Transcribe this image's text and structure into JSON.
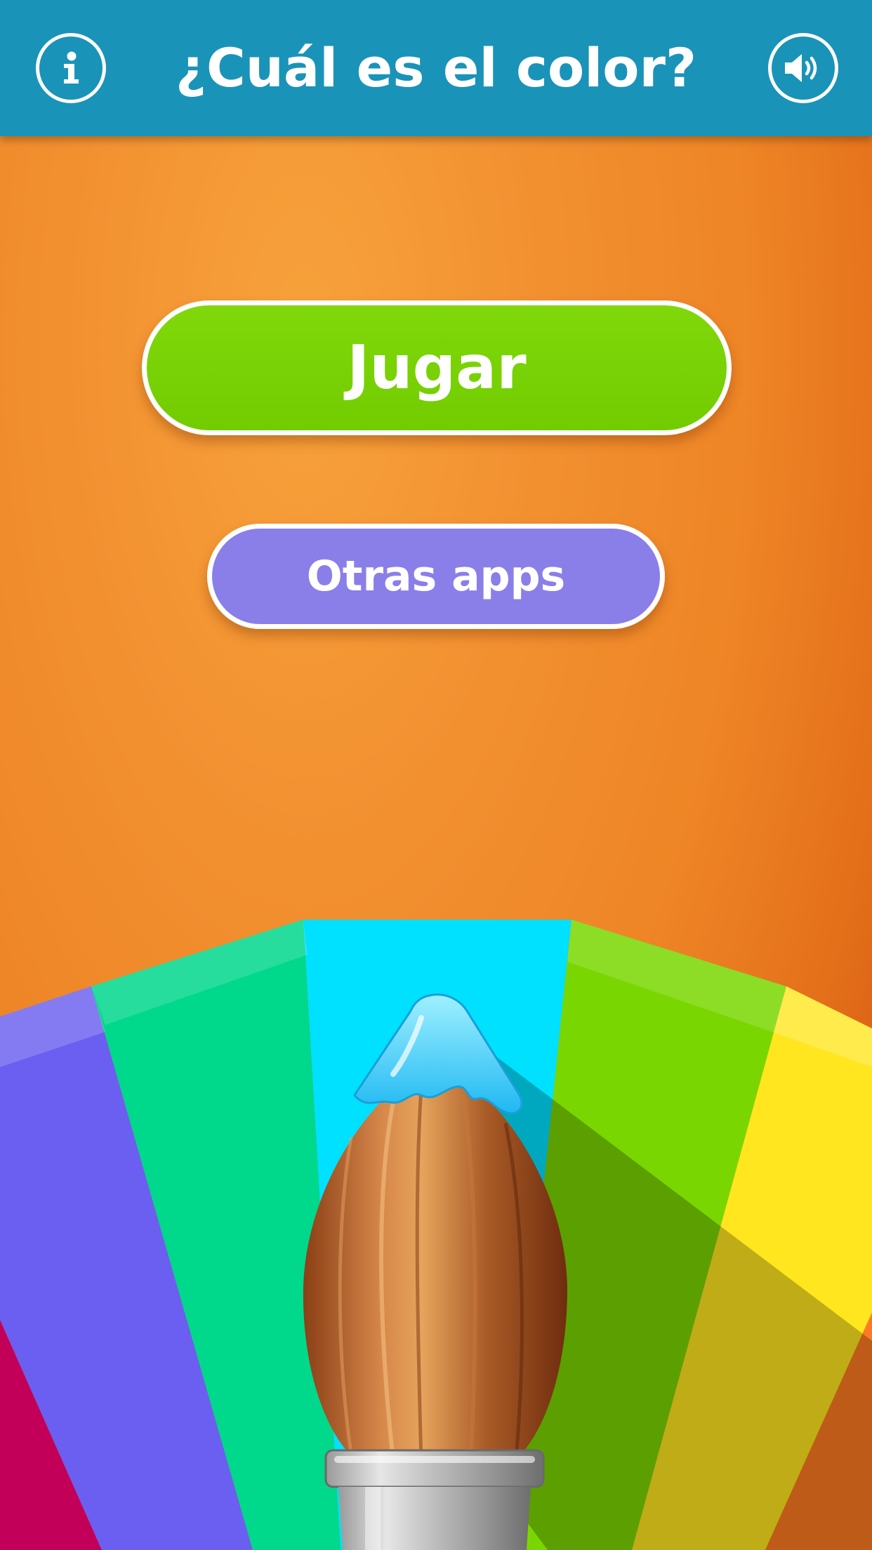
{
  "header": {
    "title": "¿Cuál es el color?",
    "info_icon": "info-icon",
    "sound_icon": "speaker-icon"
  },
  "menu": {
    "play_label": "Jugar",
    "other_apps_label": "Otras apps"
  },
  "colors": {
    "header_bg": "#1a93b8",
    "background": "#ee8526",
    "play_button": "#76cf00",
    "other_apps_button": "#8a7fe8",
    "wheel_segments": [
      "#c2005a",
      "#6a5ff0",
      "#00d88c",
      "#00e0ff",
      "#7ad600",
      "#ffe61f",
      "#ff7a22"
    ],
    "brush_tip": "#3ccfff"
  }
}
